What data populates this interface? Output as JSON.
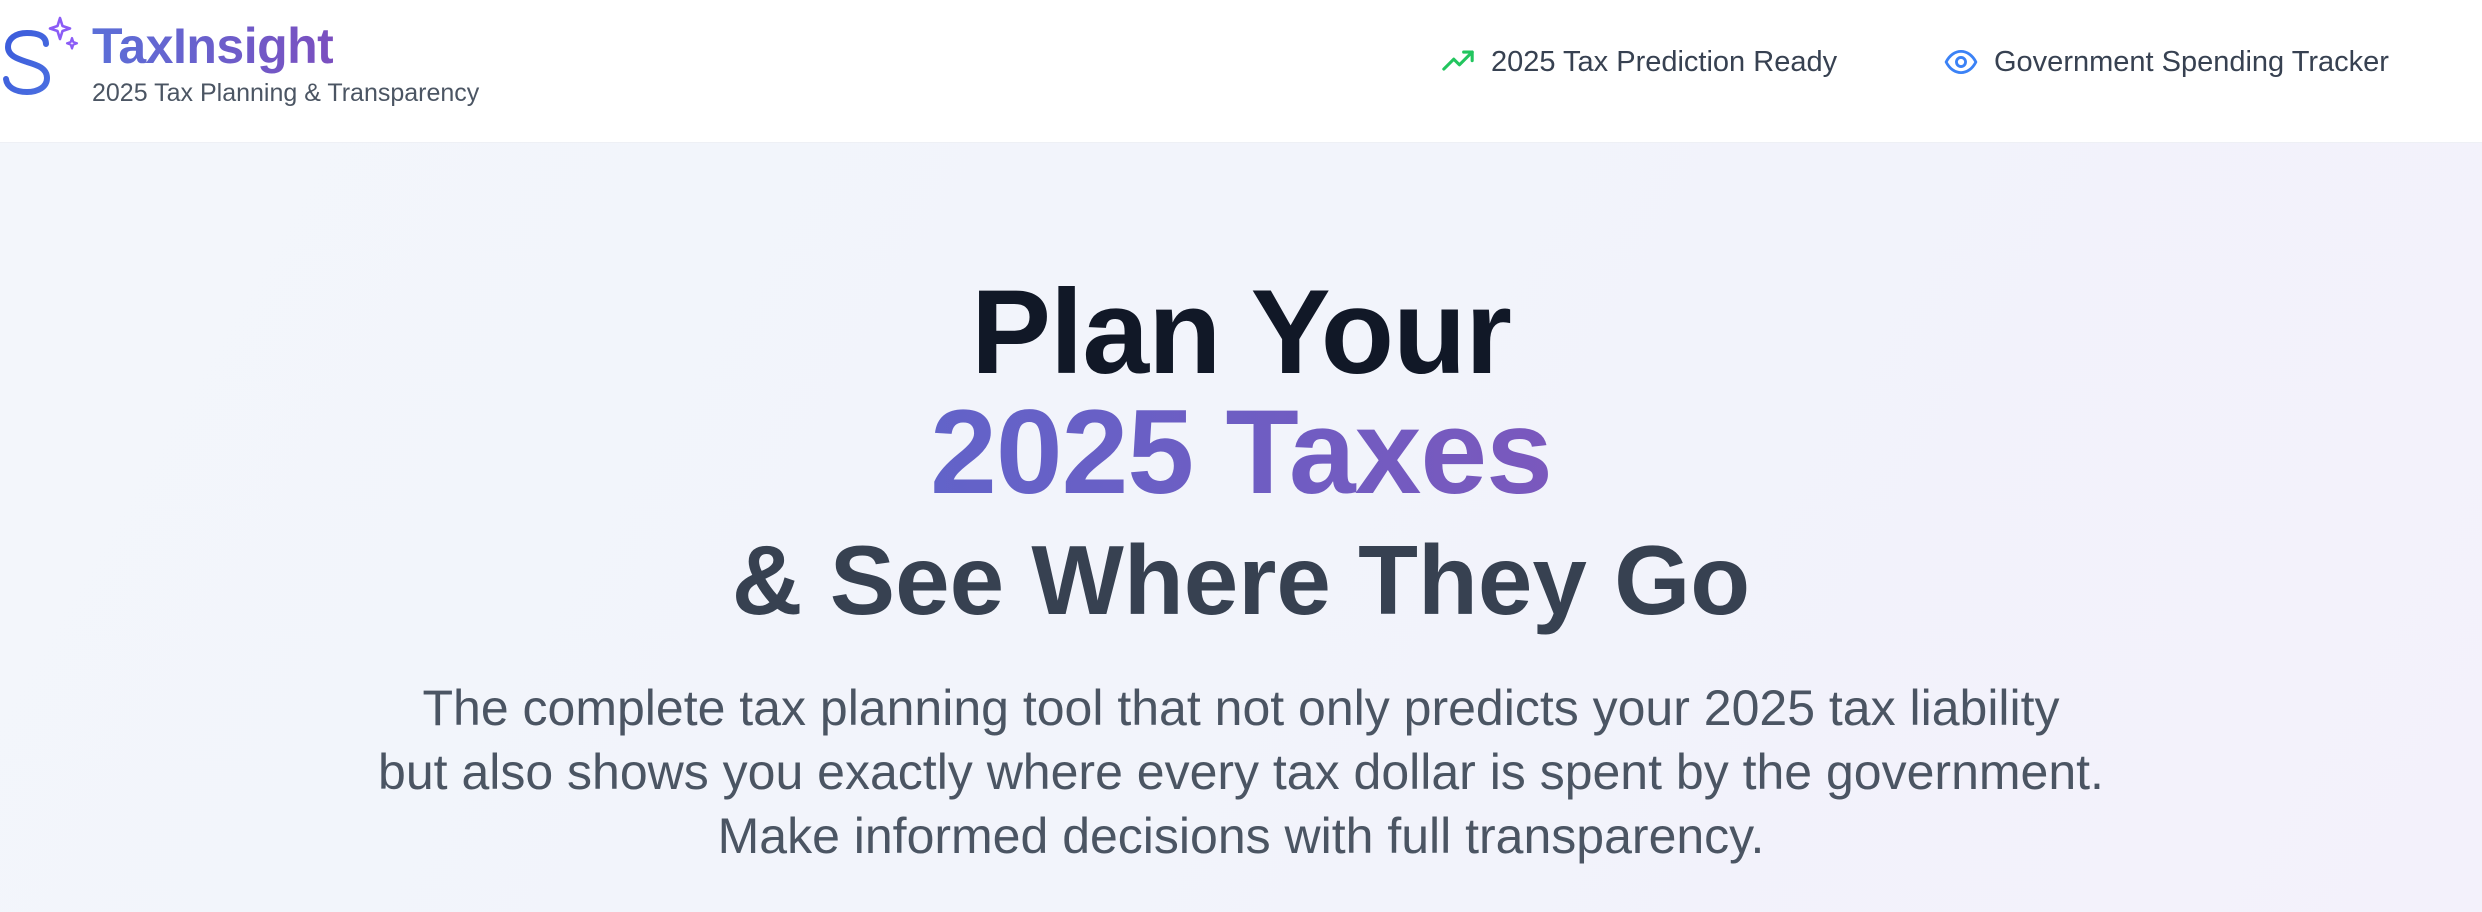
{
  "header": {
    "brand_title": "TaxInsight",
    "brand_subtitle": "2025 Tax Planning & Transparency",
    "nav": [
      {
        "label": "2025 Tax Prediction Ready",
        "icon": "trending-up-icon",
        "icon_color": "#22c55e"
      },
      {
        "label": "Government Spending Tracker",
        "icon": "eye-icon",
        "icon_color": "#3b82f6"
      }
    ]
  },
  "hero": {
    "headline_line1": "Plan Your",
    "headline_line2": "2025 Taxes",
    "headline_line3": "& See Where They Go",
    "description_lines": [
      "The complete tax planning tool that not only predicts your 2025 tax liability",
      "but also shows you exactly where every tax dollar is spent by the government.",
      "Make informed decisions with full transparency."
    ]
  },
  "colors": {
    "brand_blue": "#3b5bdb",
    "brand_purple": "#7b4fbf",
    "accent_green": "#22c55e",
    "accent_blue": "#3b82f6",
    "headline_dark": "#111827"
  }
}
